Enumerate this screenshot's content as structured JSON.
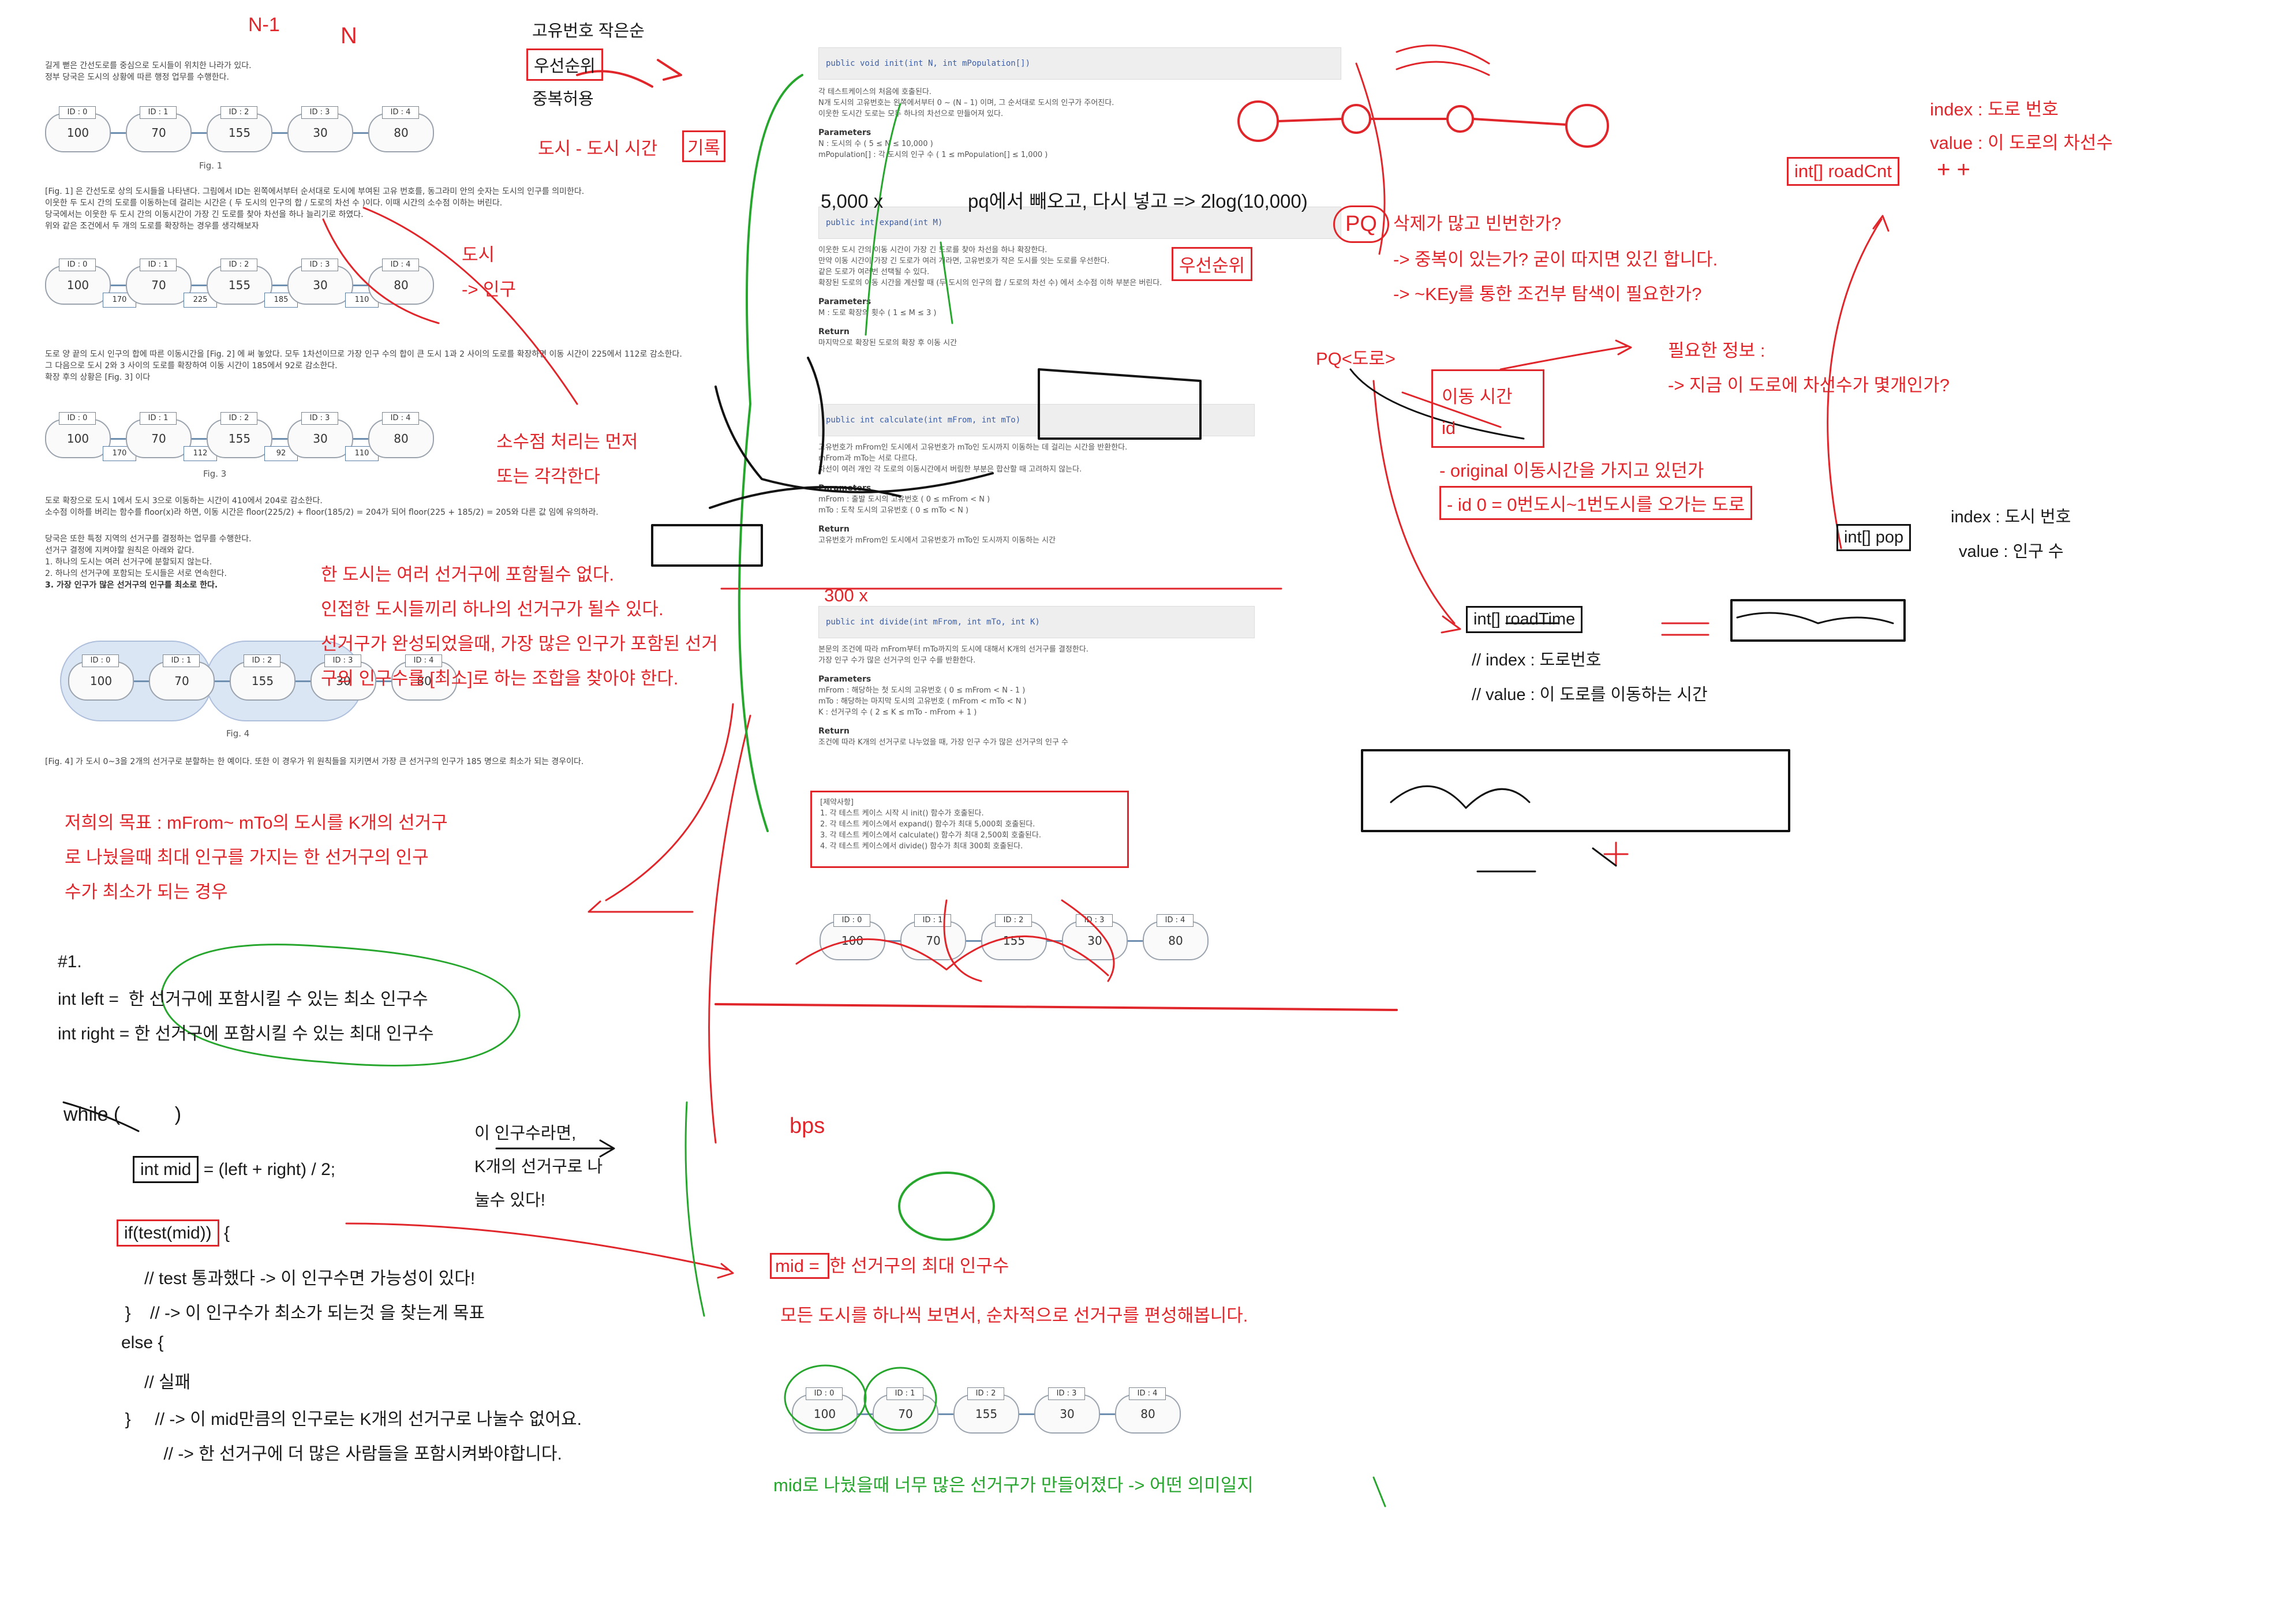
{
  "problem": {
    "intro": [
      "길게 뻗은 간선도로를 중심으로 도시들이 위치한 나라가 있다.",
      "정부 당국은 도시의 상황에 따른 행정 업무를 수행한다."
    ],
    "fig1_caption": "Fig. 1",
    "fig1_cities": [
      {
        "id": "ID : 0",
        "pop": "100"
      },
      {
        "id": "ID : 1",
        "pop": "70"
      },
      {
        "id": "ID : 2",
        "pop": "155"
      },
      {
        "id": "ID : 3",
        "pop": "30"
      },
      {
        "id": "ID : 4",
        "pop": "80"
      }
    ],
    "para2": [
      "[Fig. 1] 은 간선도로 상의 도시들을 나타낸다. 그림에서 ID는 왼쪽에서부터 순서대로 도시에 부여된 고유 번호를, 동그라미 안의 숫자는 도시의 인구를 의미한다.",
      "이웃한 두 도시 간의 도로를 이동하는데 걸리는 시간은 ( 두 도시의 인구의 합 / 도로의 차선 수 )이다. 이때 시간의 소수점 이하는 버린다.",
      "당국에서는 이웃한 두 도시 간의 이동시간이 가장 긴 도로를 찾아 차선을 하나 늘리기로 하였다.",
      "위와 같은 조건에서 두 개의 도로를 확장하는 경우를 생각해보자"
    ],
    "fig2_cities": [
      {
        "id": "ID : 0",
        "pop": "100"
      },
      {
        "id": "ID : 1",
        "pop": "70"
      },
      {
        "id": "ID : 2",
        "pop": "155"
      },
      {
        "id": "ID : 3",
        "pop": "30"
      },
      {
        "id": "ID : 4",
        "pop": "80"
      }
    ],
    "fig2_roads": [
      "170",
      "225",
      "185",
      "110"
    ],
    "para3": [
      "도로 양 끝의 도시 인구의 합에 따른 이동시간을 [Fig. 2] 에 써 놓았다. 모두 1차선이므로 가장 인구 수의 합이 큰 도시 1과 2 사이의 도로를 확장하면 이동 시간이 225에서 112로 감소한다.",
      "그 다음으로 도시 2와 3 사이의 도로를 확장하여 이동 시간이 185에서 92로 감소한다.",
      "확장 후의 상황은 [Fig. 3] 이다"
    ],
    "fig3_cities": [
      {
        "id": "ID : 0",
        "pop": "100"
      },
      {
        "id": "ID : 1",
        "pop": "70"
      },
      {
        "id": "ID : 2",
        "pop": "155"
      },
      {
        "id": "ID : 3",
        "pop": "30"
      },
      {
        "id": "ID : 4",
        "pop": "80"
      }
    ],
    "fig3_roads": [
      "170",
      "112",
      "92",
      "110"
    ],
    "fig3_caption": "Fig. 3",
    "para4": [
      "도로 확장으로 도시 1에서 도시 3으로 이동하는 시간이 410에서 204로 감소한다.",
      "소수점 이하를 버리는 함수를 floor(x)라 하면, 이동 시간은 floor(225/2) + floor(185/2) = 204가 되어 floor(225 + 185/2) = 205와 다른 값 임에 유의하라."
    ],
    "para5": [
      "당국은 또한 특정 지역의 선거구를 결정하는 업무를 수행한다.",
      "선거구 결정에 지켜야할 원칙은 아래와 같다."
    ],
    "rules": [
      "1. 하나의 도시는 여러 선거구에 분할되지 않는다.",
      "2. 하나의 선거구에 포함되는 도시들은 서로 연속한다.",
      "3. 가장 인구가 많은 선거구의 인구를 최소로 한다."
    ],
    "fig4_cities": [
      {
        "id": "ID : 0",
        "pop": "100"
      },
      {
        "id": "ID : 1",
        "pop": "70"
      },
      {
        "id": "ID : 2",
        "pop": "155"
      },
      {
        "id": "ID : 3",
        "pop": "30"
      },
      {
        "id": "ID : 4",
        "pop": "80"
      }
    ],
    "fig4_caption": "Fig. 4",
    "fig4_text": "[Fig. 4] 가 도시 0~3을 2개의 선거구로 분할하는 한 예이다. 또한 이 경우가 위 원칙들을 지키면서 가장 큰 선거구의 인구가 185 명으로 최소가 되는 경우이다."
  },
  "api": {
    "init_sig": "public void init(int N, int mPopulation[])",
    "init_desc": [
      "각 테스트케이스의 처음에 호출된다.",
      "N개 도시의 고유번호는 왼쪽에서부터 0 ~ (N – 1) 이며, 그 순서대로 도시의 인구가 주어진다.",
      "이웃한 도시간 도로는 모두 하나의 차선으로 만들어져 있다."
    ],
    "params_title": "Parameters",
    "init_params": [
      "N : 도시의 수 ( 5 ≤ N ≤ 10,000 )",
      "mPopulation[] : 각 도시의 인구 수 ( 1 ≤ mPopulation[] ≤ 1,000 )"
    ],
    "expand_sig": "public int expand(int M)",
    "expand_desc": [
      "이웃한 도시 간의 이동 시간이 가장 긴 도로를 찾아 차선을 하나 확장한다.",
      "만약 이동 시간이 가장 긴 도로가 여러 개라면, 고유번호가 작은 도시를 잇는 도로를 우선한다.",
      "같은 도로가 여러번 선택될 수 있다.",
      "확장된 도로의 이동 시간을 계산할 때 (두 도시의 인구의 합 / 도로의 차선 수) 에서 소수점 이하 부분은 버린다."
    ],
    "expand_params": [
      "M : 도로 확장의 횟수 ( 1 ≤ M ≤ 3 )"
    ],
    "return_title": "Return",
    "expand_return": "마지막으로 확장된 도로의 확장 후 이동 시간",
    "calculate_sig": "public int calculate(int mFrom, int mTo)",
    "calculate_desc": [
      "고유번호가 mFrom인 도시에서 고유번호가 mTo인 도시까지 이동하는 데 걸리는 시간을 반환한다.",
      "mFrom과 mTo는 서로 다르다.",
      "차선이 여러 개인 각 도로의 이동시간에서 버림한 부분은 합산할 때 고려하지 않는다."
    ],
    "calculate_params": [
      "mFrom : 출발 도시의 고유번호 ( 0 ≤ mFrom < N )",
      "mTo : 도착 도시의 고유번호 ( 0 ≤ mTo < N )"
    ],
    "calculate_return": "고유번호가 mFrom인 도시에서 고유번호가 mTo인 도시까지 이동하는 시간",
    "divide_sig": "public int divide(int mFrom, int mTo, int K)",
    "divide_desc": [
      "본문의 조건에 따라 mFrom부터 mTo까지의 도시에 대해서 K개의 선거구를 결정한다.",
      "가장 인구 수가 많은 선거구의 인구 수를 반환한다."
    ],
    "divide_params": [
      "mFrom : 해당하는 첫 도시의 고유번호 ( 0 ≤ mFrom < N - 1 )",
      "mTo : 해당하는 마지막 도시의 고유번호 ( mFrom < mTo < N )",
      "K : 선거구의 수 ( 2 ≤ K ≤ mTo - mFrom + 1 )"
    ],
    "divide_return": "조건에 따라 K개의 선거구로 나누었을 때, 가장 인구 수가 많은 선거구의 인구 수",
    "constraints_title": "[제약사항]",
    "constraints": [
      "1. 각 테스트 케이스 시작 시 init() 함수가 호출된다.",
      "2. 각 테스트 케이스에서 expand() 함수가 최대 5,000회 호출된다.",
      "3. 각 테스트 케이스에서 calculate() 함수가 최대 2,500회 호출된다.",
      "4. 각 테스트 케이스에서 divide() 함수가 최대 300회 호출된다."
    ],
    "mid_fig_cities": [
      {
        "id": "ID : 0",
        "pop": "100"
      },
      {
        "id": "ID : 1",
        "pop": "70"
      },
      {
        "id": "ID : 2",
        "pop": "155"
      },
      {
        "id": "ID : 3",
        "pop": "30"
      },
      {
        "id": "ID : 4",
        "pop": "80"
      }
    ],
    "bottom_fig_cities": [
      {
        "id": "ID : 0",
        "pop": "100"
      },
      {
        "id": "ID : 1",
        "pop": "70"
      },
      {
        "id": "ID : 2",
        "pop": "155"
      },
      {
        "id": "ID : 3",
        "pop": "30"
      },
      {
        "id": "ID : 4",
        "pop": "80"
      }
    ]
  },
  "notes": {
    "n1": "N-1",
    "n": "N",
    "priority_1": "고유번호 작은순",
    "priority_2": "우선순위",
    "priority_3": "중복허용",
    "city_time_a": "도시 - 도시 시간",
    "city_time_b": "기록",
    "city_arrow_1": "도시",
    "city_arrow_2": "-> 인구",
    "decimal_1": "소수점 처리는 먼저",
    "decimal_2": "또는 각각한다",
    "rule_1": "한 도시는 여러 선거구에 포함될수 없다.",
    "rule_2": "인접한 도시들끼리 하나의 선거구가 될수 있다.",
    "rule_3": "선거구가 완성되었을때, 가장 많은 인구가 포함된 선거",
    "rule_4": "구의 인구수를 [최소]로 하는 조합을 찾아야 한다.",
    "goal_1": "저희의 목표 : mFrom~ mTo의 도시를 K개의 선거구",
    "goal_2": "로 나눴을때 최대 인구를 가지는 한 선거구의 인구",
    "goal_3": "수가 최소가 되는 경우",
    "bs_header": "#1.",
    "bs_left": "int left =  한 선거구에 포함시킬 수 있는 최소 인구수",
    "bs_right": "int right = 한 선거구에 포함시킬 수 있는 최대 인구수",
    "while": "while (          )",
    "mid_a": "int mid",
    "mid_b": " = (left + right) / 2;",
    "mid_note_1": "이 인구수라면,",
    "mid_note_2": "K개의 선거구로 나",
    "mid_note_3": "눌수 있다!",
    "if_a": "if(test(mid))",
    "if_b": " {",
    "pass_1": "      // test 통과했다 -> 이 인구수면 가능성이 있다!",
    "pass_2": "  }    // -> 이 인구수가 최소가 되는것 을 찾는게 목표",
    "else": "else {",
    "fail_1": "      // 실패",
    "fail_2": "  }     // -> 이 mid만큼의 인구로는 K개의 선거구로 나눌수 없어요.",
    "fail_3": "          // -> 한 선거구에 더 많은 사람들을 포함시켜봐야합니다.",
    "heap": "5,000 x                pq에서 빼오고, 다시 넣고 => 2log(10,000)",
    "seg_300": "300 x",
    "pq": "PQ",
    "priority_side": "우선순위",
    "del_1": "삭제가 많고 빈번한가?",
    "del_2": "-> 중복이 있는가? 굳이 따지면 있긴 합니다.",
    "del_3": "-> ~KEy를 통한 조건부 탐색이 필요한가?",
    "pq_road": "PQ<도로>",
    "need_1": "필요한 정보 :",
    "need_2": "-> 지금 이 도로에 차선수가 몇개인가?",
    "move_time": "이동 시간",
    "id": "id",
    "original": "- original 이동시간을 가지고 있던가",
    "id0": "- id 0 = 0번도시~1번도시를 오가는 도로",
    "rc_index": "index : 도로 번호",
    "rc_value": "value : 이 도로의 차선수",
    "rc_name": "int[] roadCnt",
    "pop_index": "index : 도시 번호",
    "pop_value": "value : 인구 수",
    "pop_name": "int[] pop",
    "rt_name": "int[] roadTime",
    "rt_index": "// index : 도로번호",
    "rt_value": "// value : 이 도로를 이동하는 시간",
    "mid_def_a": "mid = ",
    "mid_def_b": "한 선거구의 최대 인구수",
    "sweep": "모든 도시를 하나씩 보면서, 순차적으로 선거구를 편성해봅니다.",
    "too_many": "mid로 나눴을때 너무 많은 선거구가 만들어졌다 -> 어떤 의미일지",
    "bs_abbr": "bps"
  },
  "colors": {
    "red": "#e0262b",
    "green": "#27a62e",
    "black": "#111111",
    "road": "#6f8fb0"
  }
}
